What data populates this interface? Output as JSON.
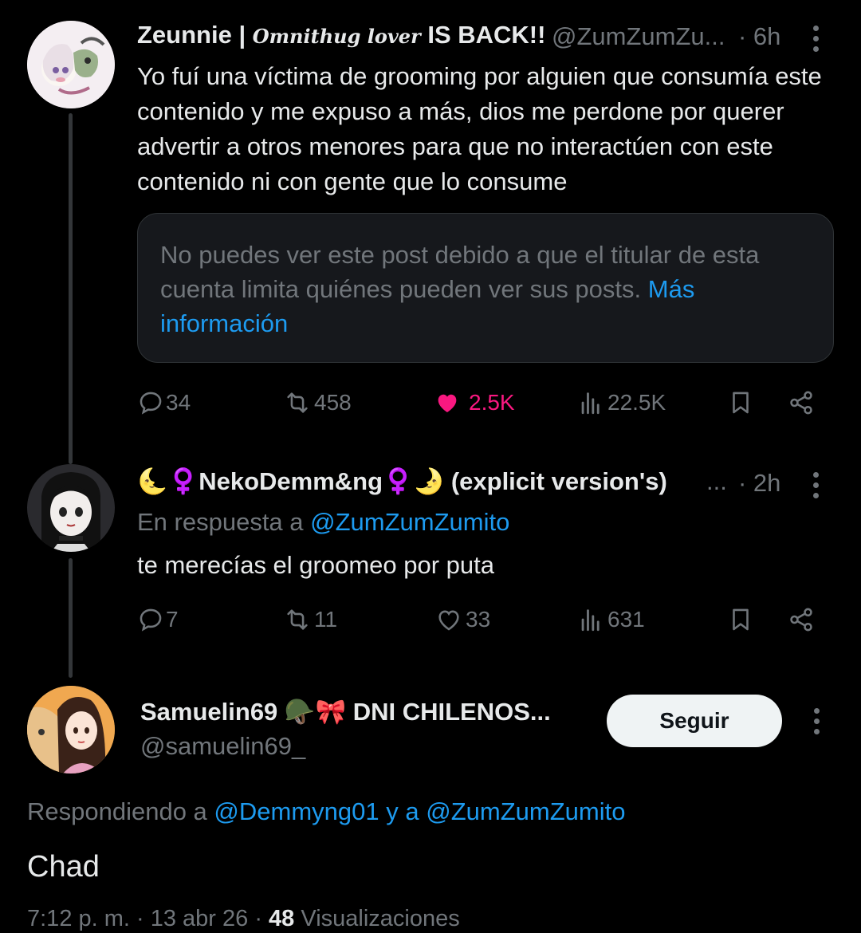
{
  "tweet1": {
    "display_name_a": "Zeunnie | ",
    "display_name_script": "Omnithug lover",
    "display_name_b": " IS BACK!!",
    "handle": "@ZumZumZu...",
    "time": "· 6h",
    "text": "Yo fuí una víctima de grooming por alguien que consumía este contenido y me expuso a más, dios me perdone por querer advertir a otros menores para que no interactúen con este contenido ni con gente que lo consume",
    "notice_text": "No puedes ver este post debido a que el titular de esta cuenta limita quiénes pueden ver sus posts. ",
    "notice_link": "Más información",
    "replies": "34",
    "reposts": "458",
    "likes": "2.5K",
    "views": "22.5K",
    "liked": true
  },
  "tweet2": {
    "display_name": "🌜♀️NekoDemm&ng♀️🌛 (explicit version's)",
    "ellipsis": "...",
    "time": "· 2h",
    "replying_prefix": "En respuesta a ",
    "replying_handle": "@ZumZumZumito",
    "text": "te merecías el groomeo por puta",
    "replies": "7",
    "reposts": "11",
    "likes": "33",
    "views": "631"
  },
  "tweet3": {
    "display_name": "Samuelin69 🪖🎀 DNI CHILENOS...",
    "handle": "@samuelin69_",
    "follow_label": "Seguir",
    "replying_prefix": "Respondiendo a ",
    "replying_handle_1": "@Demmyng01",
    "replying_joiner": " y a ",
    "replying_handle_2": "@ZumZumZumito",
    "text": "Chad",
    "meta_time": "7:12 p. m. · 13 abr 26 · ",
    "meta_views_count": "48",
    "meta_views_label": " Visualizaciones"
  },
  "colors": {
    "background": "#000000",
    "text": "#e7e9ea",
    "muted": "#71767b",
    "link": "#1d9bf0",
    "like": "#f91880"
  },
  "icons": [
    "reply-icon",
    "repost-icon",
    "heart-icon",
    "views-icon",
    "bookmark-icon",
    "share-icon",
    "more-icon"
  ]
}
